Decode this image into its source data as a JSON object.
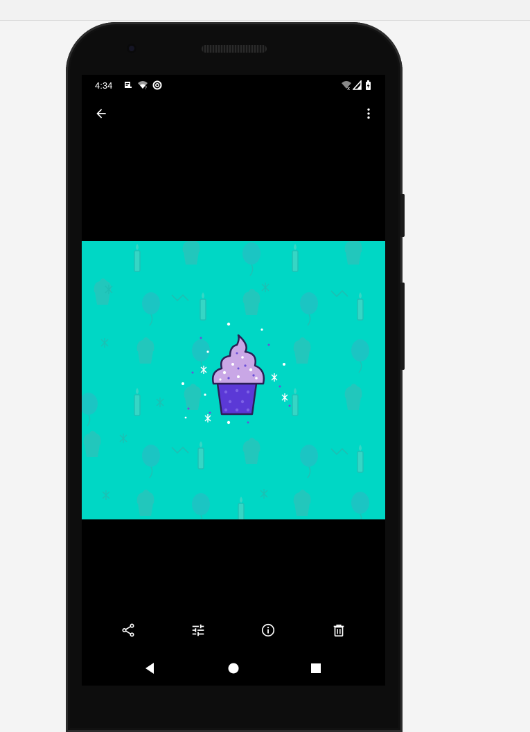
{
  "status_bar": {
    "time": "4:34",
    "left_icons": [
      "notification-icon",
      "wifi-question-icon",
      "data-saver-icon"
    ],
    "right_icons": [
      "wifi-off-icon",
      "cell-signal-icon",
      "battery-charging-icon"
    ]
  },
  "toolbar": {
    "back_icon": "arrow-back-icon",
    "more_icon": "more-vert-icon"
  },
  "photo": {
    "subject": "cupcake-illustration",
    "background_color": "#00d7c5",
    "pattern_color": "#2dc4bd",
    "frosting_color": "#c9a7e6",
    "cup_color": "#5b39d6"
  },
  "actions": [
    {
      "icon": "share-icon"
    },
    {
      "icon": "edit-tune-icon"
    },
    {
      "icon": "info-icon"
    },
    {
      "icon": "delete-icon"
    }
  ],
  "nav_bar": {
    "icons": [
      "nav-back-icon",
      "nav-home-icon",
      "nav-recents-icon"
    ]
  }
}
